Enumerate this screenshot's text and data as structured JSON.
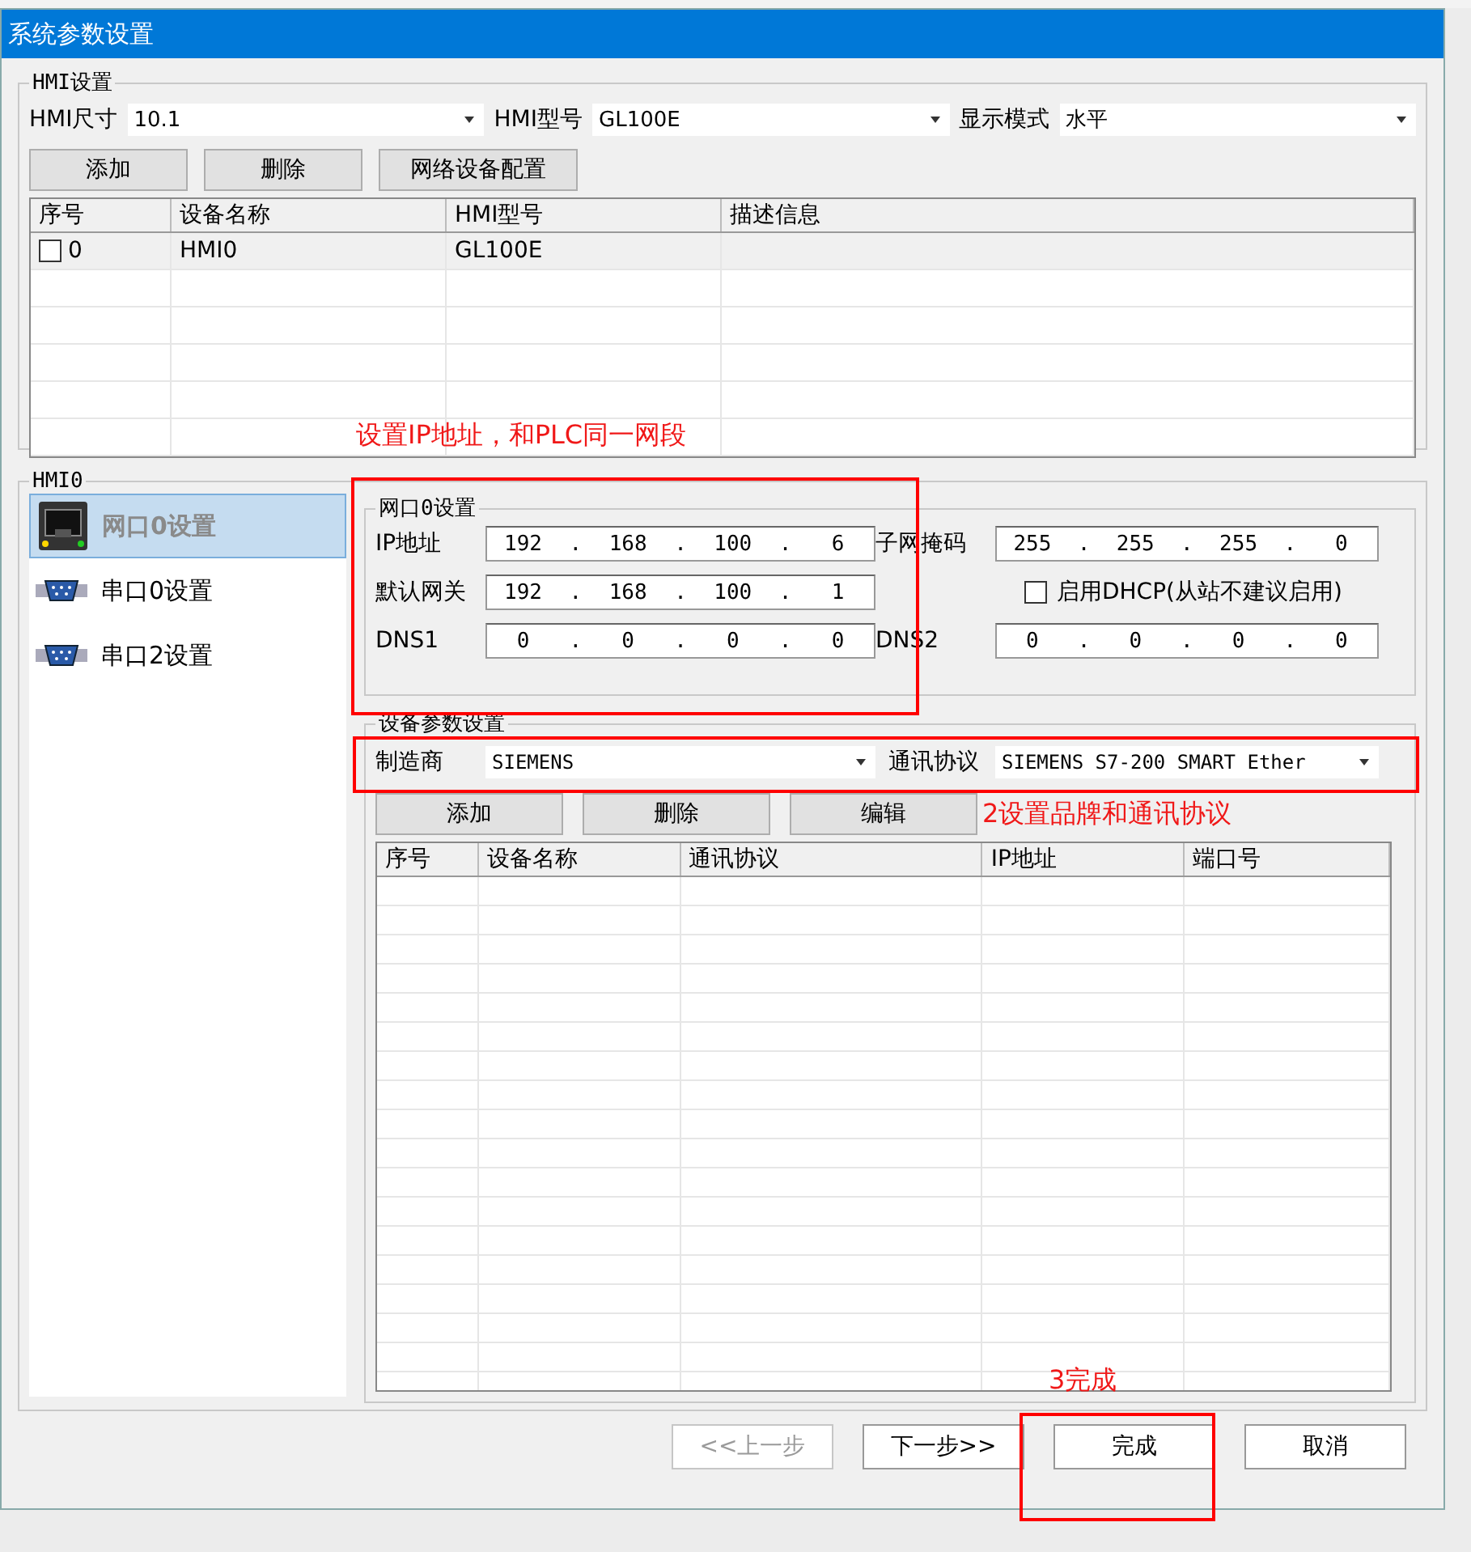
{
  "window": {
    "title": "系统参数设置"
  },
  "hmi_settings": {
    "title": "HMI设置",
    "fields": [
      {
        "label": "HMI尺寸",
        "value": "10.1"
      },
      {
        "label": "HMI型号",
        "value": "GL100E"
      },
      {
        "label": "显示模式",
        "value": "水平"
      }
    ],
    "buttons": [
      "添加",
      "删除",
      "网络设备配置"
    ],
    "table": {
      "columns": [
        "序号",
        "设备名称",
        "HMI型号",
        "描述信息"
      ],
      "rows": [
        {
          "index": "0",
          "checked": false,
          "name": "HMI0",
          "model": "GL100E"
        }
      ]
    }
  },
  "hmi0": {
    "title": "HMI0",
    "nav": [
      {
        "label": "网口0设置",
        "kind": "ethernet",
        "selected": true
      },
      {
        "label": "串口0设置",
        "kind": "serial",
        "selected": false
      },
      {
        "label": "串口2设置",
        "kind": "serial",
        "selected": false
      }
    ]
  },
  "net_port": {
    "title": "网口0设置",
    "ip": {
      "label": "IP地址",
      "octets": [
        "192",
        "168",
        "100",
        "6"
      ],
      "separators": [
        ".",
        ".",
        "."
      ]
    },
    "mask": {
      "label": "子网掩码",
      "octets": [
        "255",
        "255",
        "255",
        "0"
      ],
      "separators": [
        ".",
        ".",
        "."
      ]
    },
    "gateway": {
      "label": "默认网关",
      "octets": [
        "192",
        "168",
        "100",
        "1"
      ],
      "separators": [
        ".",
        ".",
        "."
      ]
    },
    "dhcp": {
      "label": "启用DHCP(从站不建议启用)",
      "checked": false
    },
    "dns1": {
      "label": "DNS1",
      "octets": [
        "0",
        "0",
        "0",
        "0"
      ],
      "separators": [
        ".",
        ".",
        "."
      ]
    },
    "dns2": {
      "label": "DNS2",
      "octets": [
        "0",
        "0",
        "0",
        "0"
      ],
      "separators": [
        ".",
        ".",
        "."
      ]
    }
  },
  "device_params": {
    "title": "设备参数设置",
    "manufacturer": {
      "label": "制造商",
      "value": "SIEMENS"
    },
    "protocol": {
      "label": "通讯协议",
      "value": "SIEMENS S7-200 SMART Ether"
    },
    "buttons": [
      "添加",
      "删除",
      "编辑"
    ],
    "table": {
      "columns": [
        "序号",
        "设备名称",
        "通讯协议",
        "IP地址",
        "端口号"
      ]
    }
  },
  "footer_buttons": [
    {
      "label": "<<上一步",
      "disabled": true
    },
    {
      "label": "下一步>>",
      "disabled": false
    },
    {
      "label": "完成",
      "disabled": false
    },
    {
      "label": "取消",
      "disabled": false
    }
  ],
  "annotations": [
    {
      "text": "设置IP地址，和PLC同一网段"
    },
    {
      "text": "2设置品牌和通讯协议"
    },
    {
      "text": "3完成"
    }
  ]
}
